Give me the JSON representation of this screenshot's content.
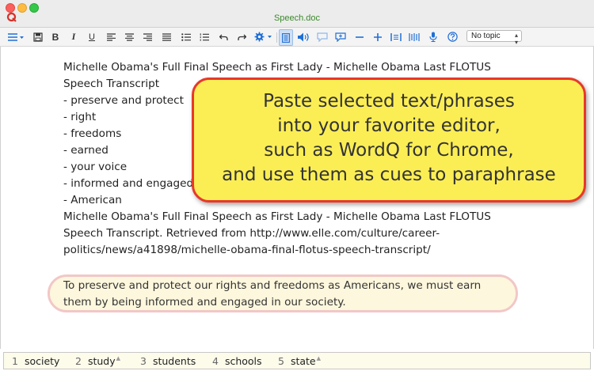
{
  "window": {
    "title": "Speech.doc"
  },
  "toolbar": {
    "topic_select": "No topic",
    "icons": [
      "menu-icon",
      "save-icon",
      "bold-icon",
      "italic-icon",
      "underline-icon",
      "align-left-icon",
      "align-center-icon",
      "align-right-icon",
      "justify-icon",
      "bullets-icon",
      "numbered-list-icon",
      "undo-icon",
      "redo-icon",
      "settings-icon",
      "read-icon",
      "speak-icon",
      "comment-icon",
      "add-comment-icon",
      "minus-icon",
      "plus-icon",
      "spacing-icon",
      "columns-icon",
      "microphone-icon",
      "help-icon"
    ]
  },
  "document": {
    "lines": [
      "Michelle Obama's Full Final Speech as First Lady - Michelle Obama Last FLOTUS",
      "Speech Transcript",
      "- preserve and protect",
      "- right",
      "- freedoms",
      "- earned",
      "- your voice",
      "- informed and engaged",
      "- American",
      "Michelle Obama's Full Final Speech as First Lady - Michelle Obama Last FLOTUS",
      "Speech Transcript. Retrieved from http://www.elle.com/culture/career-",
      "politics/news/a41898/michelle-obama-final-flotus-speech-transcript/"
    ],
    "paraphrase_lines": [
      "To preserve and protect our rights and freedoms as Americans, we must earn",
      "them by being informed and engaged in our society."
    ]
  },
  "callout": {
    "lines": [
      "Paste selected text/phrases",
      "into your favorite editor,",
      "such as WordQ for Chrome,",
      "and use them as cues to paraphrase"
    ]
  },
  "predictions": [
    {
      "num": "1",
      "word": "society",
      "flag": ""
    },
    {
      "num": "2",
      "word": "study",
      "flag": "▲"
    },
    {
      "num": "3",
      "word": "students",
      "flag": ""
    },
    {
      "num": "4",
      "word": "schools",
      "flag": ""
    },
    {
      "num": "5",
      "word": "state",
      "flag": "▲"
    }
  ],
  "colors": {
    "title": "#3a8a2a",
    "callout_fill": "#fbee55",
    "callout_border": "#e8382a",
    "paraphrase_fill": "#fdf7dd",
    "paraphrase_border": "#f2c7c7",
    "accent": "#1f6fd6"
  }
}
